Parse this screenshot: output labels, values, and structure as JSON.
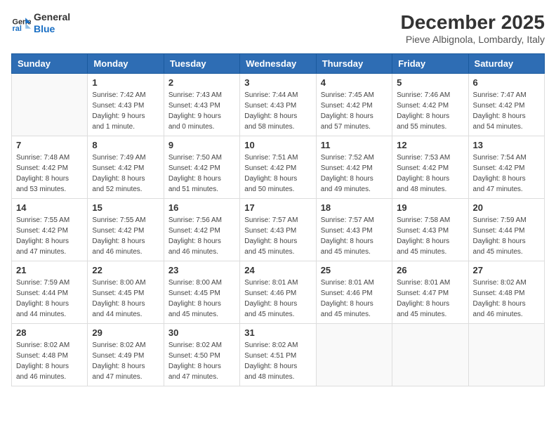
{
  "logo": {
    "line1": "General",
    "line2": "Blue"
  },
  "title": "December 2025",
  "location": "Pieve Albignola, Lombardy, Italy",
  "days_header": [
    "Sunday",
    "Monday",
    "Tuesday",
    "Wednesday",
    "Thursday",
    "Friday",
    "Saturday"
  ],
  "weeks": [
    [
      {
        "num": "",
        "info": ""
      },
      {
        "num": "1",
        "info": "Sunrise: 7:42 AM\nSunset: 4:43 PM\nDaylight: 9 hours\nand 1 minute."
      },
      {
        "num": "2",
        "info": "Sunrise: 7:43 AM\nSunset: 4:43 PM\nDaylight: 9 hours\nand 0 minutes."
      },
      {
        "num": "3",
        "info": "Sunrise: 7:44 AM\nSunset: 4:43 PM\nDaylight: 8 hours\nand 58 minutes."
      },
      {
        "num": "4",
        "info": "Sunrise: 7:45 AM\nSunset: 4:42 PM\nDaylight: 8 hours\nand 57 minutes."
      },
      {
        "num": "5",
        "info": "Sunrise: 7:46 AM\nSunset: 4:42 PM\nDaylight: 8 hours\nand 55 minutes."
      },
      {
        "num": "6",
        "info": "Sunrise: 7:47 AM\nSunset: 4:42 PM\nDaylight: 8 hours\nand 54 minutes."
      }
    ],
    [
      {
        "num": "7",
        "info": "Sunrise: 7:48 AM\nSunset: 4:42 PM\nDaylight: 8 hours\nand 53 minutes."
      },
      {
        "num": "8",
        "info": "Sunrise: 7:49 AM\nSunset: 4:42 PM\nDaylight: 8 hours\nand 52 minutes."
      },
      {
        "num": "9",
        "info": "Sunrise: 7:50 AM\nSunset: 4:42 PM\nDaylight: 8 hours\nand 51 minutes."
      },
      {
        "num": "10",
        "info": "Sunrise: 7:51 AM\nSunset: 4:42 PM\nDaylight: 8 hours\nand 50 minutes."
      },
      {
        "num": "11",
        "info": "Sunrise: 7:52 AM\nSunset: 4:42 PM\nDaylight: 8 hours\nand 49 minutes."
      },
      {
        "num": "12",
        "info": "Sunrise: 7:53 AM\nSunset: 4:42 PM\nDaylight: 8 hours\nand 48 minutes."
      },
      {
        "num": "13",
        "info": "Sunrise: 7:54 AM\nSunset: 4:42 PM\nDaylight: 8 hours\nand 47 minutes."
      }
    ],
    [
      {
        "num": "14",
        "info": "Sunrise: 7:55 AM\nSunset: 4:42 PM\nDaylight: 8 hours\nand 47 minutes."
      },
      {
        "num": "15",
        "info": "Sunrise: 7:55 AM\nSunset: 4:42 PM\nDaylight: 8 hours\nand 46 minutes."
      },
      {
        "num": "16",
        "info": "Sunrise: 7:56 AM\nSunset: 4:42 PM\nDaylight: 8 hours\nand 46 minutes."
      },
      {
        "num": "17",
        "info": "Sunrise: 7:57 AM\nSunset: 4:43 PM\nDaylight: 8 hours\nand 45 minutes."
      },
      {
        "num": "18",
        "info": "Sunrise: 7:57 AM\nSunset: 4:43 PM\nDaylight: 8 hours\nand 45 minutes."
      },
      {
        "num": "19",
        "info": "Sunrise: 7:58 AM\nSunset: 4:43 PM\nDaylight: 8 hours\nand 45 minutes."
      },
      {
        "num": "20",
        "info": "Sunrise: 7:59 AM\nSunset: 4:44 PM\nDaylight: 8 hours\nand 45 minutes."
      }
    ],
    [
      {
        "num": "21",
        "info": "Sunrise: 7:59 AM\nSunset: 4:44 PM\nDaylight: 8 hours\nand 44 minutes."
      },
      {
        "num": "22",
        "info": "Sunrise: 8:00 AM\nSunset: 4:45 PM\nDaylight: 8 hours\nand 44 minutes."
      },
      {
        "num": "23",
        "info": "Sunrise: 8:00 AM\nSunset: 4:45 PM\nDaylight: 8 hours\nand 45 minutes."
      },
      {
        "num": "24",
        "info": "Sunrise: 8:01 AM\nSunset: 4:46 PM\nDaylight: 8 hours\nand 45 minutes."
      },
      {
        "num": "25",
        "info": "Sunrise: 8:01 AM\nSunset: 4:46 PM\nDaylight: 8 hours\nand 45 minutes."
      },
      {
        "num": "26",
        "info": "Sunrise: 8:01 AM\nSunset: 4:47 PM\nDaylight: 8 hours\nand 45 minutes."
      },
      {
        "num": "27",
        "info": "Sunrise: 8:02 AM\nSunset: 4:48 PM\nDaylight: 8 hours\nand 46 minutes."
      }
    ],
    [
      {
        "num": "28",
        "info": "Sunrise: 8:02 AM\nSunset: 4:48 PM\nDaylight: 8 hours\nand 46 minutes."
      },
      {
        "num": "29",
        "info": "Sunrise: 8:02 AM\nSunset: 4:49 PM\nDaylight: 8 hours\nand 47 minutes."
      },
      {
        "num": "30",
        "info": "Sunrise: 8:02 AM\nSunset: 4:50 PM\nDaylight: 8 hours\nand 47 minutes."
      },
      {
        "num": "31",
        "info": "Sunrise: 8:02 AM\nSunset: 4:51 PM\nDaylight: 8 hours\nand 48 minutes."
      },
      {
        "num": "",
        "info": ""
      },
      {
        "num": "",
        "info": ""
      },
      {
        "num": "",
        "info": ""
      }
    ]
  ]
}
